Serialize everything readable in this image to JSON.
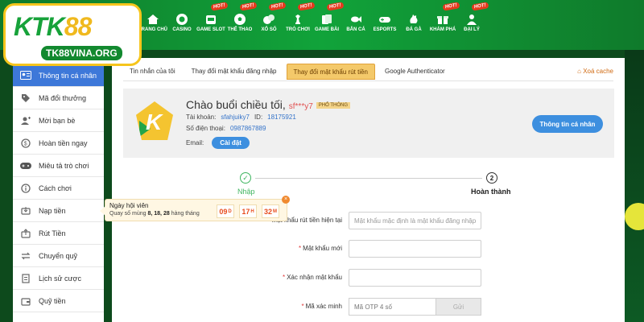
{
  "nav": [
    {
      "label": "TRANG CHỦ",
      "icon": "home-icon",
      "hot": ""
    },
    {
      "label": "CASINO",
      "icon": "casino-chip-icon",
      "hot": ""
    },
    {
      "label": "GAME SLOT",
      "icon": "slot-icon",
      "hot": "HOT!"
    },
    {
      "label": "THỂ THAO",
      "icon": "soccer-icon",
      "hot": "HOT!"
    },
    {
      "label": "XỔ SỐ",
      "icon": "lottery-icon",
      "hot": "HOT!"
    },
    {
      "label": "TRÒ CHƠI",
      "icon": "chess-icon",
      "hot": "HOT!"
    },
    {
      "label": "GAME BÀI",
      "icon": "cards-icon",
      "hot": "HOT!"
    },
    {
      "label": "BẮN CÁ",
      "icon": "fish-icon",
      "hot": ""
    },
    {
      "label": "ESPORTS",
      "icon": "gamepad-icon",
      "hot": ""
    },
    {
      "label": "ĐÁ GÀ",
      "icon": "rooster-icon",
      "hot": ""
    },
    {
      "label": "KHÁM PHÁ",
      "icon": "gift-icon",
      "hot": "HOT!"
    },
    {
      "label": "ĐẠI LÝ",
      "icon": "agent-icon",
      "hot": "HOT!"
    }
  ],
  "logo": {
    "brand_a": "KTK",
    "brand_b": "88",
    "url": "TK88VINA.ORG"
  },
  "sidebar": [
    {
      "label": "Thông tin cá nhân",
      "icon": "user-card-icon",
      "active": true
    },
    {
      "label": "Mã đổi thưởng",
      "icon": "tag-icon",
      "active": false
    },
    {
      "label": "Mời bạn bè",
      "icon": "invite-icon",
      "active": false
    },
    {
      "label": "Hoàn tiền ngay",
      "icon": "refund-icon",
      "active": false
    },
    {
      "label": "Miêu tả trò chơi",
      "icon": "gamepad-icon",
      "active": false
    },
    {
      "label": "Cách chơi",
      "icon": "info-icon",
      "active": false
    },
    {
      "label": "Nạp tiền",
      "icon": "deposit-icon",
      "active": false
    },
    {
      "label": "Rút Tiền",
      "icon": "withdraw-icon",
      "active": false
    },
    {
      "label": "Chuyển quỹ",
      "icon": "transfer-icon",
      "active": false
    },
    {
      "label": "Lịch sử cược",
      "icon": "history-icon",
      "active": false
    },
    {
      "label": "Quỹ tiền",
      "icon": "wallet-icon",
      "active": false
    }
  ],
  "tabs": [
    {
      "label": "Tin nhắn của tôi",
      "active": false
    },
    {
      "label": "Thay đổi mật khẩu đăng nhập",
      "active": false
    },
    {
      "label": "Thay đổi mật khẩu rút tiền",
      "active": true
    },
    {
      "label": "Google Authenticator",
      "active": false
    }
  ],
  "clear_cache": "Xoá cache",
  "profile": {
    "greeting": "Chào buổi chiều tối,",
    "nickname": "sf***y7",
    "rank": "PHỔ THÔNG",
    "account_label": "Tài khoản:",
    "account": "sfahjuiky7",
    "id_label": "ID:",
    "id": "18175921",
    "phone_label": "Số điện thoại:",
    "phone": "0987867889",
    "email_label": "Email:",
    "email_button": "Cài đặt",
    "info_button": "Thông tin cá nhân"
  },
  "steps": {
    "step1": "Nhập",
    "step2": "Hoàn thành",
    "step2_num": "2",
    "step1_mark": "✓"
  },
  "form": {
    "current_label": "Mật khẩu rút tiền hiện tại",
    "current_placeholder": "Mật khẩu mặc định là mật khẩu đăng nhập",
    "new_label": "Mật khẩu mới",
    "confirm_label": "Xác nhận mật khẩu",
    "otp_label": "Mã xác minh",
    "otp_placeholder": "Mã OTP 4 số",
    "send_button": "Gửi"
  },
  "popup": {
    "title": "Ngày hội viên",
    "subtitle_pre": "Quay số mùng",
    "subtitle_days": "8, 18, 28",
    "subtitle_post": "hàng tháng",
    "days": "09",
    "days_unit": "D",
    "hours": "17",
    "hours_unit": "H",
    "minutes": "32",
    "minutes_unit": "M",
    "close": "×"
  },
  "colors": {
    "nav_green": "#11a33a",
    "active_blue": "#3d78d9",
    "tab_gold": "#f4c96a",
    "accent_orange": "#e84c1e"
  }
}
